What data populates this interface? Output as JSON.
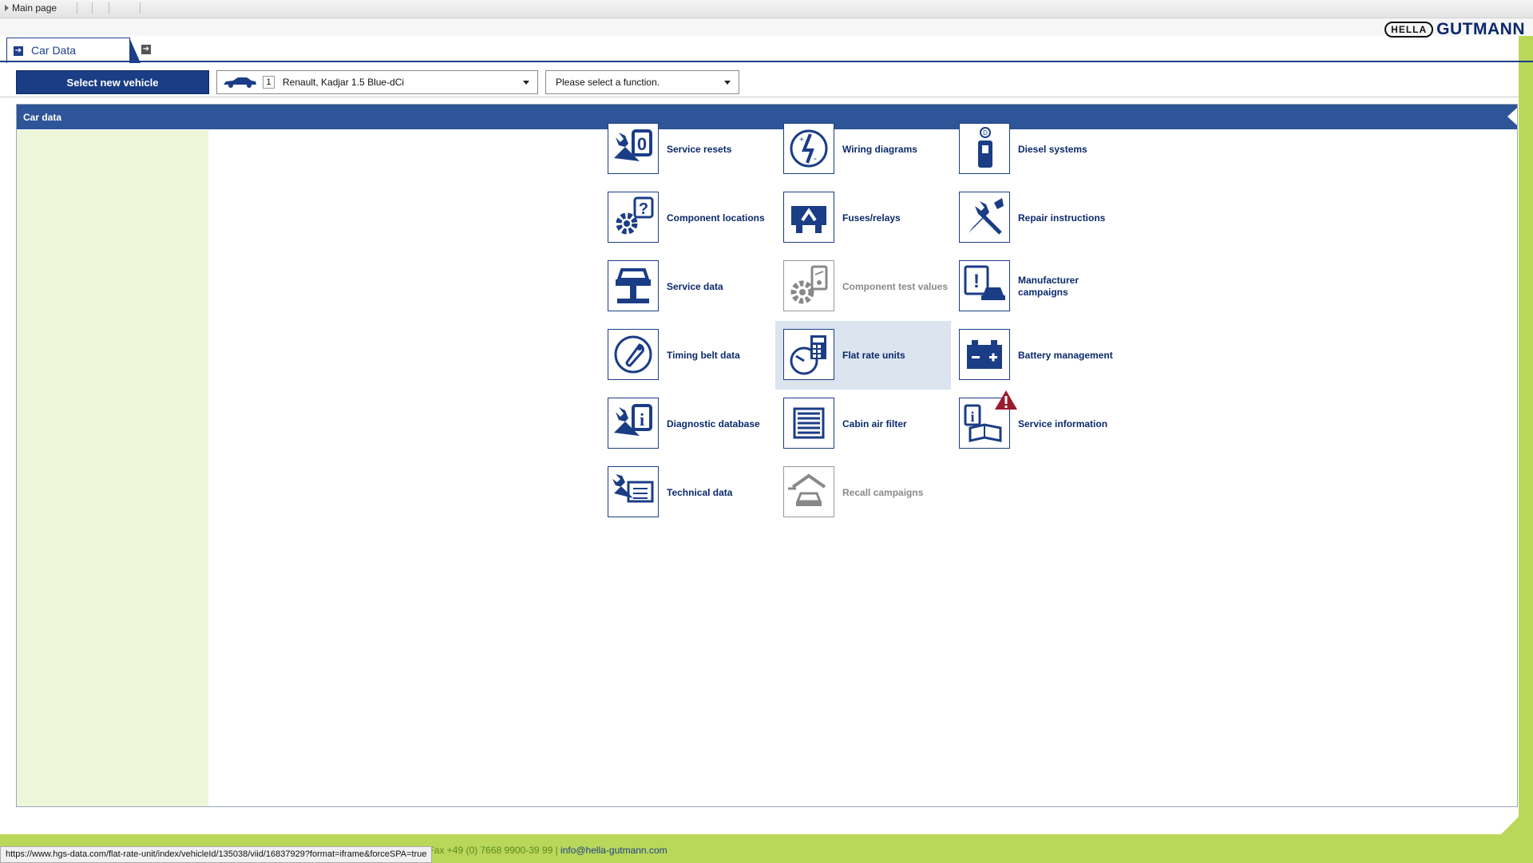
{
  "topbar": {
    "breadcrumb": "Main page"
  },
  "logo": {
    "hella": "HELLA",
    "gutmann": "GUTMANN"
  },
  "tabs": [
    {
      "label": "Car Data"
    }
  ],
  "toolbar": {
    "select_vehicle_label": "Select new vehicle",
    "vehicle_index": "1",
    "vehicle_name": "Renault, Kadjar 1.5 Blue-dCi",
    "function_placeholder": "Please select a function."
  },
  "panel": {
    "title": "Car data"
  },
  "functions": [
    {
      "label": "Service resets",
      "icon": "wrench-zero-icon",
      "state": "enabled"
    },
    {
      "label": "Wiring diagrams",
      "icon": "wiring-diagram-icon",
      "state": "enabled"
    },
    {
      "label": "Diesel systems",
      "icon": "diesel-pump-icon",
      "state": "enabled"
    },
    {
      "label": "Component locations",
      "icon": "gear-question-icon",
      "state": "enabled"
    },
    {
      "label": "Fuses/relays",
      "icon": "fuse-icon",
      "state": "enabled"
    },
    {
      "label": "Repair instructions",
      "icon": "wrench-screwdriver-icon",
      "state": "enabled"
    },
    {
      "label": "Service data",
      "icon": "car-lift-icon",
      "state": "enabled"
    },
    {
      "label": "Component test values",
      "icon": "gear-meter-icon",
      "state": "disabled"
    },
    {
      "label": "Manufacturer campaigns",
      "icon": "truck-exclamation-icon",
      "state": "enabled"
    },
    {
      "label": "Timing belt data",
      "icon": "timing-belt-icon",
      "state": "enabled"
    },
    {
      "label": "Flat rate units",
      "icon": "clock-calculator-icon",
      "state": "active"
    },
    {
      "label": "Battery management",
      "icon": "battery-icon",
      "state": "enabled"
    },
    {
      "label": "Diagnostic database",
      "icon": "wrench-info-icon",
      "state": "enabled"
    },
    {
      "label": "Cabin air filter",
      "icon": "air-filter-icon",
      "state": "enabled"
    },
    {
      "label": "Service information",
      "icon": "info-book-icon",
      "state": "enabled",
      "warning": true
    },
    {
      "label": "Technical data",
      "icon": "wrench-book-icon",
      "state": "enabled"
    },
    {
      "label": "Recall campaigns",
      "icon": "garage-car-icon",
      "state": "disabled"
    }
  ],
  "footer": {
    "contact_text": "0 | Fax +49 (0) 7668 9900-39 99 | ",
    "email": "info@hella-gutmann.com",
    "status_url": "https://www.hgs-data.com/flat-rate-unit/index/vehicleId/135038/viid/16837929?format=iframe&forceSPA=true"
  },
  "colors": {
    "brand_blue": "#1b3d86",
    "header_blue": "#2d5597",
    "green": "#b9d85a",
    "sidebar": "#eef6d9",
    "warning_red": "#9b1b2e"
  }
}
